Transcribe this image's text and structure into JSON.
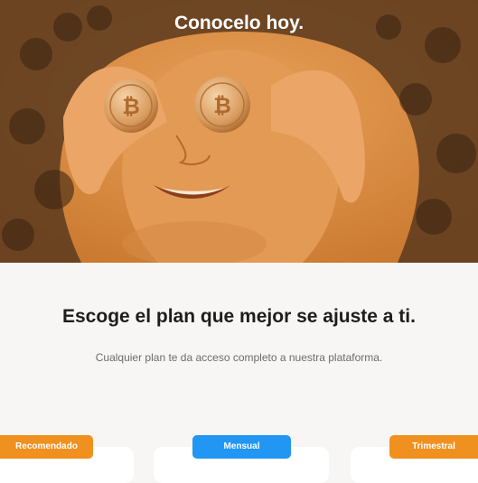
{
  "hero": {
    "title": "Conocelo hoy.",
    "image": "woman-holding-bitcoin-coins-over-eyes",
    "tint_color": "#e08a2c"
  },
  "plans_section": {
    "headline": "Escoge el plan que mejor se ajuste a ti.",
    "subline": "Cualquier plan te da acceso completo a nuestra plataforma."
  },
  "plan_tabs": [
    {
      "label": "Recomendado",
      "color": "#f0901f"
    },
    {
      "label": "Mensual",
      "color": "#2196f3"
    },
    {
      "label": "Trimestral",
      "color": "#f0901f"
    }
  ],
  "colors": {
    "background": "#f8f6f4",
    "accent_orange": "#f0901f",
    "accent_blue": "#2196f3"
  }
}
